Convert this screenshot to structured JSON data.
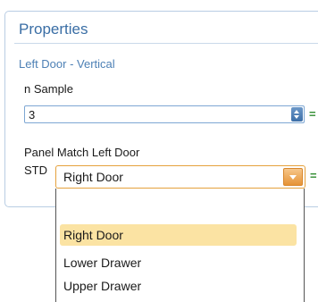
{
  "panel": {
    "title": "Properties",
    "subtitle": "Left Door - Vertical"
  },
  "fields": {
    "n_sample": {
      "label": "n Sample",
      "value": "3",
      "suffix": "="
    },
    "panel_match": {
      "label": "Panel Match Left Door",
      "prefix": "STD",
      "value": "Right Door",
      "suffix": "="
    }
  },
  "dropdown": {
    "options": [
      "Right Door",
      "Lower Drawer",
      "Upper Drawer"
    ],
    "selected_index": 0
  },
  "colors": {
    "title": "#3a6ea5",
    "subtitle": "#4d80b5",
    "combo_border": "#e5a13c",
    "selected_item": "#fbe3a3",
    "equals": "#2e8b2e"
  }
}
